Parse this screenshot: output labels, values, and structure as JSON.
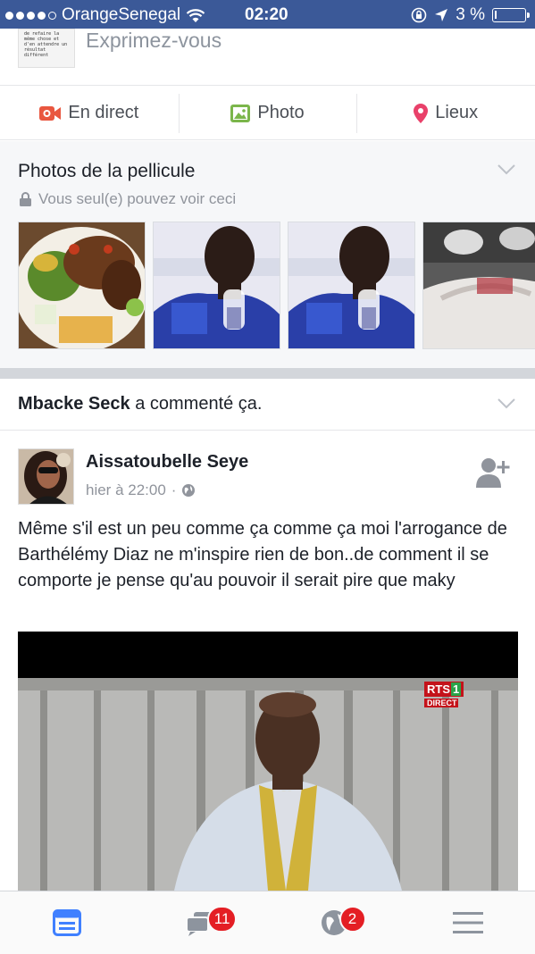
{
  "status_bar": {
    "carrier": "OrangeSenegal",
    "time": "02:20",
    "battery_percent": "3 %",
    "signal_bars_filled": 4,
    "signal_bars_total": 5
  },
  "composer": {
    "thumbnail_text": "de refaire la même chose et d'en attendre un résultat différent",
    "placeholder": "Exprimez-vous"
  },
  "actions": [
    {
      "label": "En direct",
      "icon": "video-camera-icon",
      "color": "#e9573f"
    },
    {
      "label": "Photo",
      "icon": "photo-icon",
      "color": "#7bb64b"
    },
    {
      "label": "Lieux",
      "icon": "location-pin-icon",
      "color": "#e9416a"
    }
  ],
  "camera_roll": {
    "title": "Photos de la pellicule",
    "privacy": "Vous seul(e) pouvez voir ceci"
  },
  "story": {
    "actor": "Mbacke Seck",
    "action": " a commenté ça."
  },
  "post": {
    "author": "Aissatoubelle Seye",
    "time": "hier à 22:00",
    "separator": "·",
    "text": "Même s'il est un peu comme ça comme ça moi l'arrogance de Barthélémy Diaz ne m'inspire rien de bon..de comment il se comporte je pense qu'au pouvoir il serait pire que maky",
    "video_logo": {
      "name": "RTS",
      "number": "1",
      "sub": "DIRECT"
    }
  },
  "tab_bar": {
    "tabs": [
      {
        "name": "news-feed",
        "icon": "news-feed-icon",
        "badge": ""
      },
      {
        "name": "friend-requests",
        "icon": "friend-requests-icon",
        "badge": "11"
      },
      {
        "name": "notifications",
        "icon": "globe-icon",
        "badge": "2"
      },
      {
        "name": "menu",
        "icon": "menu-icon",
        "badge": ""
      }
    ]
  },
  "colors": {
    "facebook_blue": "#3b5998",
    "tab_active": "#4080ff",
    "badge_red": "#e41e24"
  }
}
